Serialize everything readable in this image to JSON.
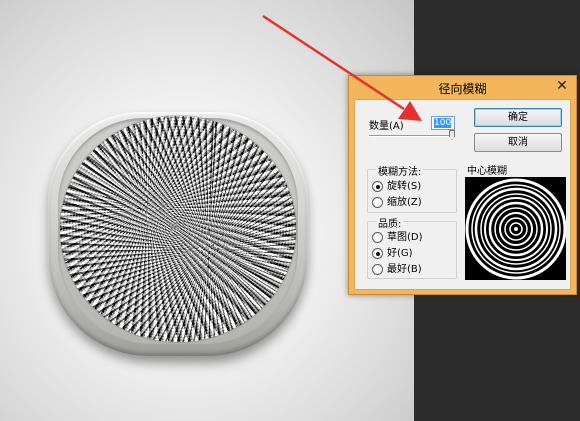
{
  "dialog": {
    "title": "径向模糊",
    "close_glyph": "✕",
    "amount_label": "数量(A)",
    "amount_value": "100",
    "ok_label": "确定",
    "cancel_label": "取消",
    "blur_method": {
      "title": "模糊方法:",
      "options": [
        "旋转(S)",
        "缩放(Z)"
      ],
      "selected": "旋转(S)"
    },
    "quality": {
      "title": "品质:",
      "options": [
        "草图(D)",
        "好(G)",
        "最好(B)"
      ],
      "selected": "好(G)"
    },
    "center_label": "中心模糊"
  },
  "annotation": {
    "arrow_color": "#e8302c"
  },
  "colors": {
    "dialog_frame": "#f3b65a",
    "dialog_client": "#f0f0f0",
    "right_panel": "#2c2c2c"
  },
  "icons": [
    "close-icon",
    "radio-icon",
    "slider-thumb-icon",
    "arrow-annotation-icon"
  ]
}
